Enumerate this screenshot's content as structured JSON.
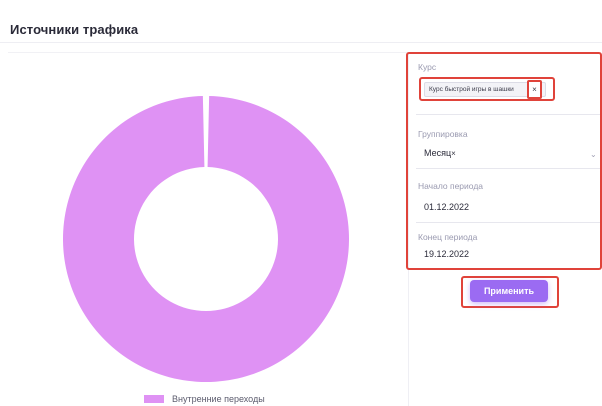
{
  "page": {
    "title": "Источники трафика"
  },
  "filters": {
    "course": {
      "label": "Курс",
      "selected_chip": "Курс быстрой игры в шашки",
      "remove_symbol": "×"
    },
    "grouping": {
      "label": "Группировка",
      "value": "Месяц",
      "clear_symbol": "×",
      "chevron": "⌄"
    },
    "period_start": {
      "label": "Начало периода",
      "value": "01.12.2022"
    },
    "period_end": {
      "label": "Конец периода",
      "value": "19.12.2022"
    },
    "apply_label": "Применить"
  },
  "chart_data": {
    "type": "pie",
    "variant": "donut",
    "slices": [
      {
        "label": "Внутренние переходы",
        "value": 100,
        "color": "#df92f4"
      }
    ],
    "legend_position": "bottom"
  },
  "colors": {
    "accent": "#9b6bf2",
    "highlight": "#e0433a",
    "slice": "#df92f4"
  }
}
